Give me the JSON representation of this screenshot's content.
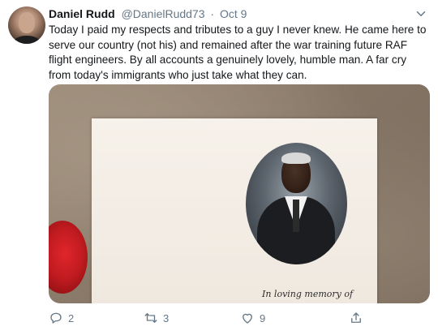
{
  "tweet": {
    "author_name": "Daniel Rudd",
    "author_handle": "@DanielRudd73",
    "separator": "·",
    "date": "Oct 9",
    "text": "Today I paid my respects and tributes to a guy I never knew. He came here to serve our country (not his) and remained after the war training future RAF flight engineers. By all accounts a genuinely lovely, humble man. A far cry from today's immigrants who just take what they can.",
    "media": {
      "card_caption": "In loving memory of"
    }
  },
  "actions": {
    "reply_count": "2",
    "retweet_count": "3",
    "like_count": "9"
  },
  "icons": {
    "more": "chevron-down-icon",
    "reply": "reply-icon",
    "retweet": "retweet-icon",
    "like": "heart-icon",
    "share": "share-icon"
  },
  "colors": {
    "text_primary": "#14171a",
    "text_secondary": "#657786"
  }
}
